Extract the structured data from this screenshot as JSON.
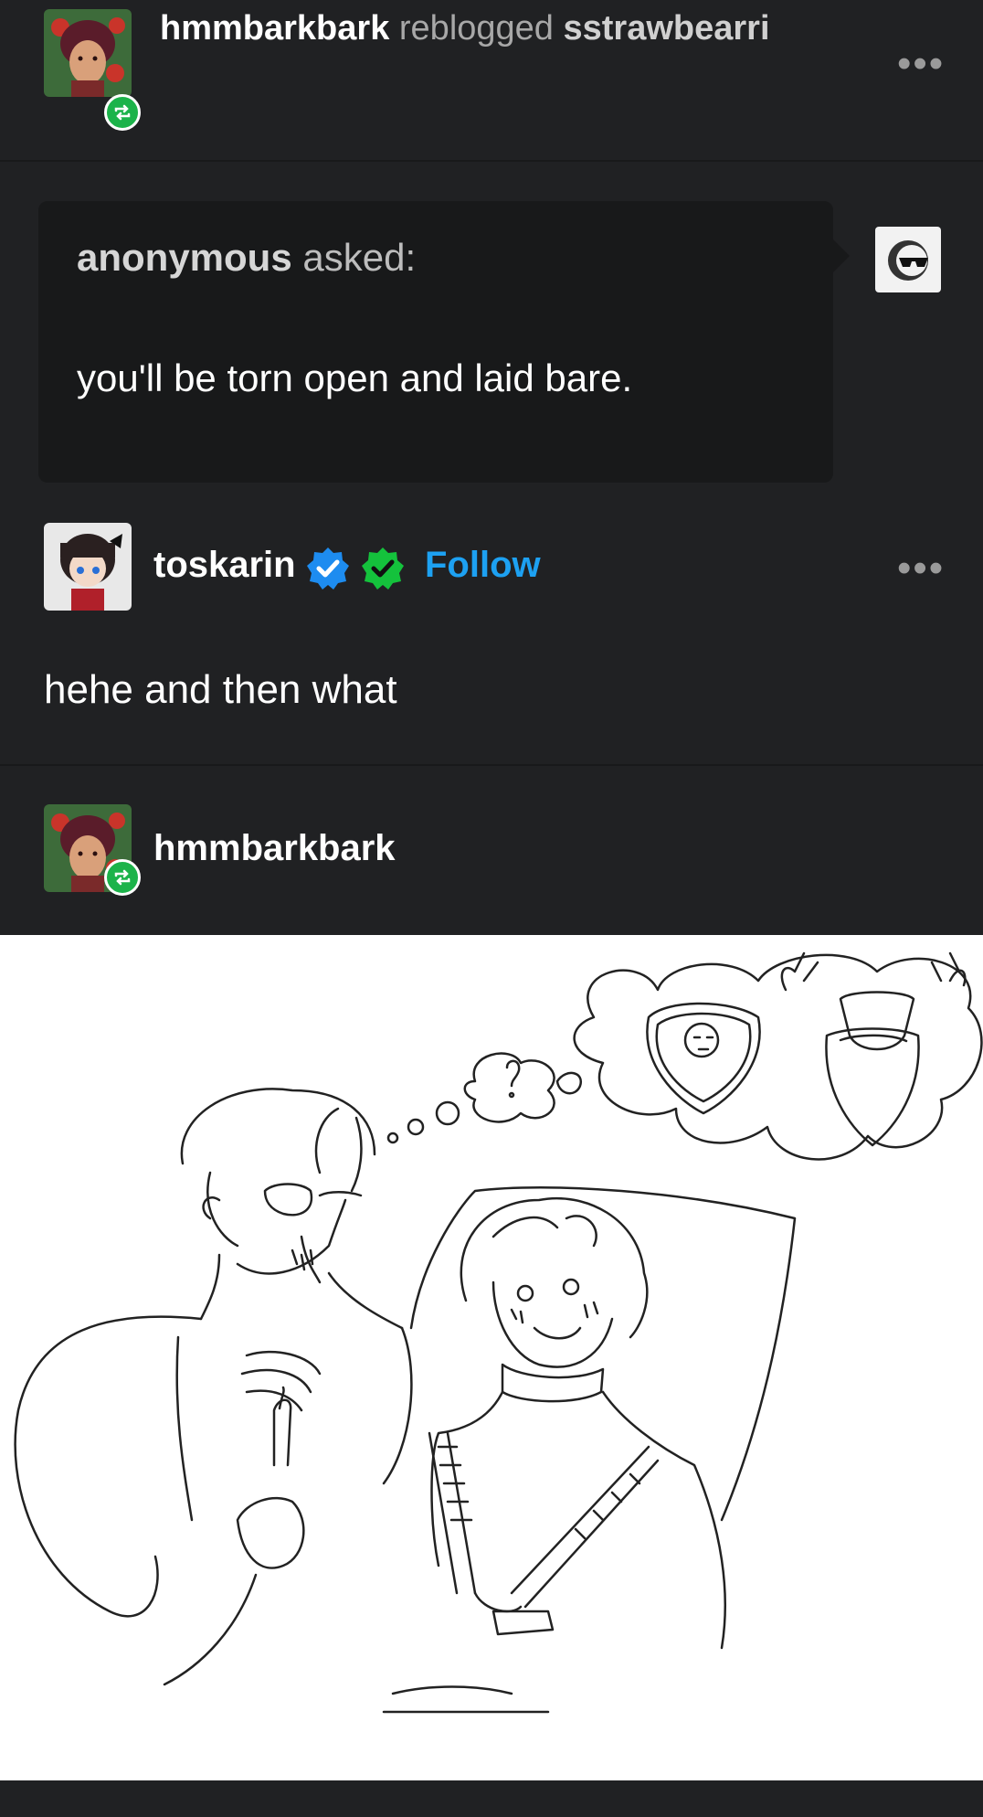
{
  "header": {
    "reblogger": "hmmbarkbark",
    "reblogged_text": "reblogged",
    "source": "sstrawbearri",
    "more_label": "•••"
  },
  "ask": {
    "asker": "anonymous",
    "asked_label": "asked:",
    "question": "you'll be torn open and laid bare."
  },
  "answer": {
    "username": "toskarin",
    "follow_label": "Follow",
    "more_label": "•••",
    "body": "hehe and then what"
  },
  "reblog": {
    "username": "hmmbarkbark"
  },
  "colors": {
    "background": "#202123",
    "ask_box": "#18191a",
    "follow_blue": "#1da1f2",
    "reblog_green": "#1cb34a"
  },
  "icons": [
    "reblog-icon",
    "verified-blue-icon",
    "verified-green-icon",
    "more-icon",
    "sunglasses-icon"
  ]
}
